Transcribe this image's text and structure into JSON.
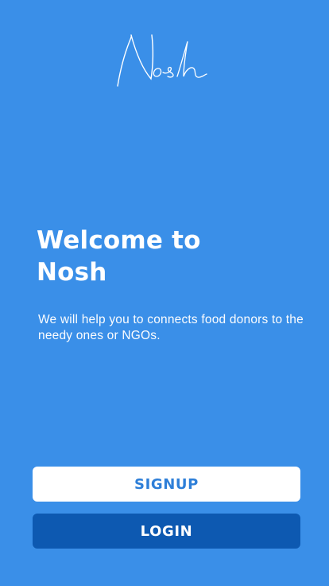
{
  "app": {
    "logo_text": "Nosh"
  },
  "welcome": {
    "title": "Welcome to\nNosh",
    "description": "We will help you to connects food donors to the needy ones or NGOs."
  },
  "actions": {
    "signup_label": "SIGNUP",
    "login_label": "LOGIN"
  },
  "colors": {
    "background": "#3a8fe8",
    "signup_bg": "#ffffff",
    "signup_text": "#2e7fd8",
    "login_bg": "#0d59b1",
    "login_text": "#ffffff"
  }
}
